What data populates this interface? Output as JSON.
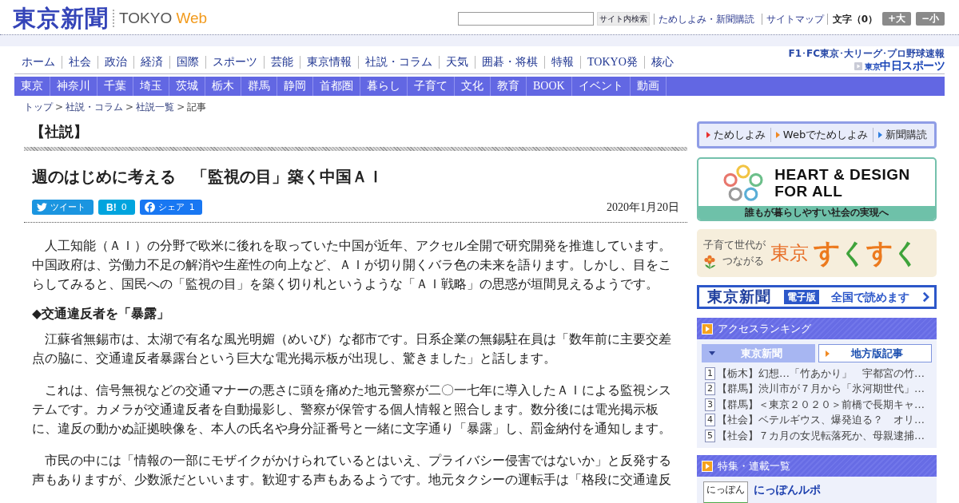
{
  "header": {
    "logo": "東京新聞",
    "edition": "TOKYO",
    "edition_suffix": "Web",
    "search_button": "サイト内検索",
    "links": [
      "ためしよみ・新聞購読",
      "サイトマップ"
    ],
    "font_size_label": "文字（0）",
    "font_buttons": [
      "+大",
      "−小"
    ]
  },
  "main_nav": [
    "ホーム",
    "社会",
    "政治",
    "経済",
    "国際",
    "スポーツ",
    "芸能",
    "東京情報",
    "社説・コラム",
    "天気",
    "囲碁・将棋",
    "特報",
    "TOKYO発",
    "核心"
  ],
  "sports_link": {
    "caption": "F1･FC東京･大リーグ･プロ野球速報",
    "logo_prefix": "東京",
    "logo": "中日スポーツ"
  },
  "region_nav": [
    "東京",
    "神奈川",
    "千葉",
    "埼玉",
    "茨城",
    "栃木",
    "群馬",
    "静岡",
    "首都圏",
    "暮らし",
    "子育て",
    "文化",
    "教育",
    "BOOK",
    "イベント",
    "動画"
  ],
  "breadcrumb": {
    "items": [
      "トップ",
      "社説・コラム",
      "社説一覧",
      "記事"
    ],
    "separator": ">"
  },
  "article": {
    "section": "【社説】",
    "title": "週のはじめに考える　「監視の目」築く中国ＡＩ",
    "share": [
      {
        "kind": "twitter",
        "label": "ツイート"
      },
      {
        "kind": "hatena",
        "label": "B!",
        "count": "0"
      },
      {
        "kind": "facebook",
        "label": "シェア",
        "count": "1"
      }
    ],
    "date": "2020年1月20日",
    "body": [
      {
        "kind": "paragraph",
        "text": "人工知能（ＡＩ）の分野で欧米に後れを取っていた中国が近年、アクセル全開で研究開発を推進しています。中国政府は、労働力不足の解消や生産性の向上など、ＡＩが切り開くバラ色の未来を語ります。しかし、目をこらしてみると、国民への「監視の目」を築く切り札というような「ＡＩ戦略」の思惑が垣間見えるようです。"
      },
      {
        "kind": "heading",
        "text": "◆交通違反者を「暴露」"
      },
      {
        "kind": "paragraph",
        "text": "江蘇省無錫市は、太湖で有名な風光明媚（めいび）な都市です。日系企業の無錫駐在員は「数年前に主要交差点の脇に、交通違反者暴露台という巨大な電光掲示板が出現し、驚きました」と話します。"
      },
      {
        "kind": "paragraph",
        "text": "これは、信号無視などの交通マナーの悪さに頭を痛めた地元警察が二〇一七年に導入したＡＩによる監視システムです。カメラが交通違反者を自動撮影し、警察が保管する個人情報と照合します。数分後には電光掲示板に、違反の動かぬ証拠映像を、本人の氏名や身分証番号と一緒に文字通り「暴露」し、罰金納付を通知します。"
      },
      {
        "kind": "paragraph",
        "text": "市民の中には「情報の一部にモザイクがかけられているとはいえ、プライバシー侵害ではないか」と反発する声もありますが、少数派だといいます。歓迎する声もあるようです。地元タクシーの運転手は「格段に交通違反"
      }
    ]
  },
  "sidebar": {
    "trial_links": [
      {
        "label": "ためしよみ",
        "color": "#e8312f"
      },
      {
        "label": "Webでためしよみ",
        "color": "#f08a24"
      },
      {
        "label": "新聞購読",
        "color": "#2f7fe0"
      }
    ],
    "banners": [
      {
        "kind": "heart_design",
        "title_1": "HEART & DESIGN",
        "title_2": "FOR ALL",
        "caption": "誰もが暮らしやすい社会の実現へ"
      },
      {
        "kind": "sukusuku",
        "lead_1": "子育て世代が",
        "lead_2": "つながる",
        "brand": "東京",
        "wordmark": "すくすく"
      },
      {
        "kind": "digital",
        "logo": "東京新聞",
        "badge": "電子版",
        "text": "全国で読めます"
      }
    ],
    "ranking": {
      "title": "アクセスランキング",
      "tabs": [
        {
          "label": "東京新聞",
          "selected": true
        },
        {
          "label": "地方版記事",
          "selected": false
        }
      ],
      "items": [
        {
          "rank": "1",
          "text": "【栃木】幻想…「竹あかり」　宇都宮の竹…"
        },
        {
          "rank": "2",
          "text": "【群馬】渋川市が７月から「氷河期世代」…"
        },
        {
          "rank": "3",
          "text": "【群馬】＜東京２０２０＞前橋で長期キャ…"
        },
        {
          "rank": "4",
          "text": "【社会】ベテルギウス、爆発迫る？　オリ…"
        },
        {
          "rank": "5",
          "text": "【社会】７カ月の女児転落死か、母親逮捕…"
        }
      ]
    },
    "features": {
      "title": "特集・連載一覧",
      "items": [
        {
          "thumbnail_text": "にっぽん",
          "title": "にっぽんルポ"
        }
      ]
    }
  }
}
